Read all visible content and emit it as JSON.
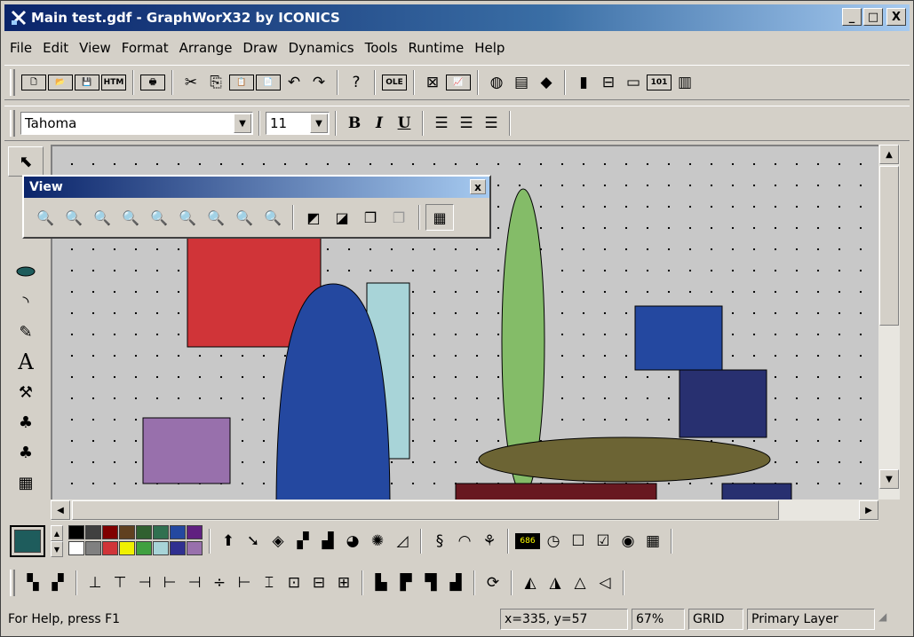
{
  "window": {
    "title": "Main test.gdf - GraphWorX32 by ICONICS"
  },
  "caption_buttons": {
    "minimize": "_",
    "maximize": "□",
    "close": "X"
  },
  "menu": [
    "File",
    "Edit",
    "View",
    "Format",
    "Arrange",
    "Draw",
    "Dynamics",
    "Tools",
    "Runtime",
    "Help"
  ],
  "toolbar1": [
    {
      "name": "new-icon",
      "glyph": "🗋"
    },
    {
      "name": "open-icon",
      "glyph": "📂"
    },
    {
      "name": "save-icon",
      "glyph": "💾"
    },
    {
      "name": "html-icon",
      "glyph": "HTM"
    },
    {
      "name": "print-icon",
      "glyph": "🖶"
    },
    {
      "name": "cut-icon",
      "glyph": "✂"
    },
    {
      "name": "copy-icon",
      "glyph": "⎘"
    },
    {
      "name": "paste-icon",
      "glyph": "📋"
    },
    {
      "name": "paste-special-icon",
      "glyph": "📄"
    },
    {
      "name": "undo-icon",
      "glyph": "↶"
    },
    {
      "name": "redo-icon",
      "glyph": "↷"
    },
    {
      "name": "help-icon",
      "glyph": "?"
    },
    {
      "name": "ole-icon",
      "glyph": "OLE"
    },
    {
      "name": "graph-icon",
      "glyph": "⊠"
    },
    {
      "name": "chart-icon",
      "glyph": "📈"
    },
    {
      "name": "gauge-icon",
      "glyph": "◍"
    },
    {
      "name": "report-icon",
      "glyph": "▤"
    },
    {
      "name": "book-icon",
      "glyph": "◆"
    },
    {
      "name": "bar-icon",
      "glyph": "▮"
    },
    {
      "name": "slider-icon",
      "glyph": "⊟"
    },
    {
      "name": "meter-icon",
      "glyph": "▭"
    },
    {
      "name": "counter-icon",
      "glyph": "101"
    },
    {
      "name": "fuel-icon",
      "glyph": "▥"
    }
  ],
  "format": {
    "font": "Tahoma",
    "size": "11",
    "bold": "B",
    "italic": "I",
    "underline": "U"
  },
  "view_palette": {
    "title": "View",
    "close": "x"
  },
  "shapes_colors": {
    "red": "#d03438",
    "light_blue": "#a8d4d8",
    "blue": "#2448a0",
    "green": "#84bc68",
    "navy": "#2448a0",
    "dark_navy": "#283070",
    "olive": "#6c6434",
    "purple": "#9870ac",
    "maroon": "#681820"
  },
  "palette": [
    "#000000",
    "#404040",
    "#800000",
    "#604020",
    "#306030",
    "#307050",
    "#2448a0",
    "#602080",
    "#ffffff",
    "#808080",
    "#d03438",
    "#f0f000",
    "#40a040",
    "#a8d4d8",
    "#303090",
    "#9870ac"
  ],
  "current_color": "#1e5c5c",
  "status": {
    "help": "For Help, press F1",
    "coords": "x=335, y=57",
    "zoom": "67%",
    "grid": "GRID",
    "layer": "Primary Layer"
  }
}
